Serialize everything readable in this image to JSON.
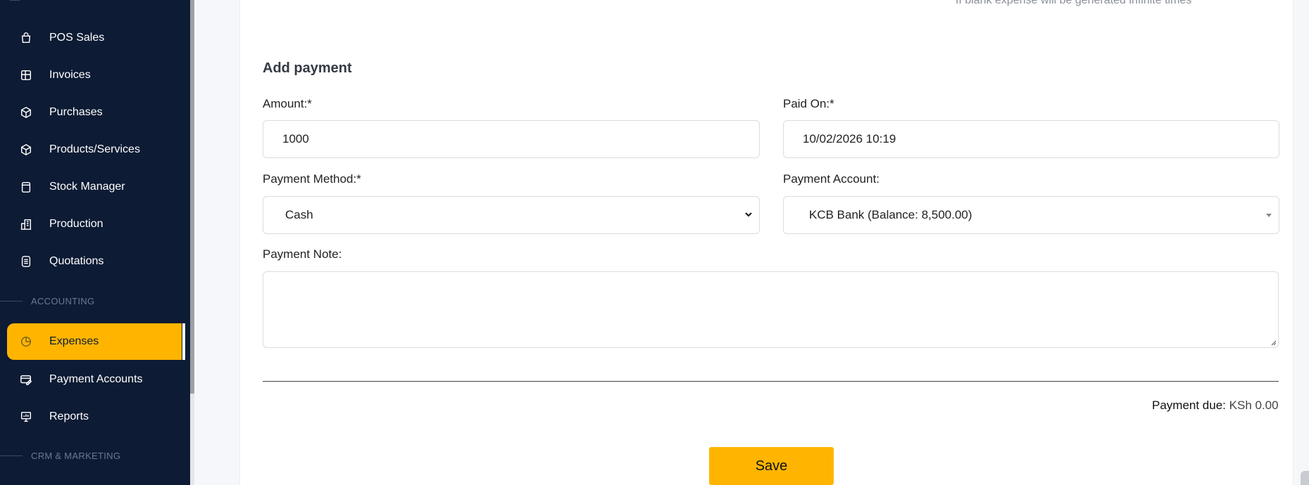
{
  "sidebar": {
    "items": [
      {
        "label": "POS Sales",
        "icon": "shopping-bag-icon"
      },
      {
        "label": "Invoices",
        "icon": "invoice-icon"
      },
      {
        "label": "Purchases",
        "icon": "purchase-box-icon"
      },
      {
        "label": "Products/Services",
        "icon": "cube-icon"
      },
      {
        "label": "Stock Manager",
        "icon": "clipboard-icon"
      },
      {
        "label": "Production",
        "icon": "building-icon"
      },
      {
        "label": "Quotations",
        "icon": "list-doc-icon"
      }
    ],
    "section_accounting": "ACCOUNTING",
    "accounting_items": [
      {
        "label": "Expenses",
        "icon": "pie-chart-icon",
        "active": true
      },
      {
        "label": "Payment Accounts",
        "icon": "card-edit-icon"
      },
      {
        "label": "Reports",
        "icon": "presentation-icon"
      }
    ],
    "section_crm": "CRM & MARKETING"
  },
  "top_hint": "If blank expense will be generated infinite times",
  "payment": {
    "heading": "Add payment",
    "amount_label": "Amount:*",
    "amount_value": "1000",
    "paid_on_label": "Paid On:*",
    "paid_on_value": "10/02/2026 10:19",
    "method_label": "Payment Method:*",
    "method_value": "Cash",
    "account_label": "Payment Account:",
    "account_value": "KCB Bank (Balance: 8,500.00)",
    "note_label": "Payment Note:",
    "due_label": "Payment due:",
    "due_value": "KSh 0.00",
    "save_label": "Save"
  },
  "colors": {
    "sidebar_bg": "#0d1b34",
    "accent": "#ffb500"
  }
}
